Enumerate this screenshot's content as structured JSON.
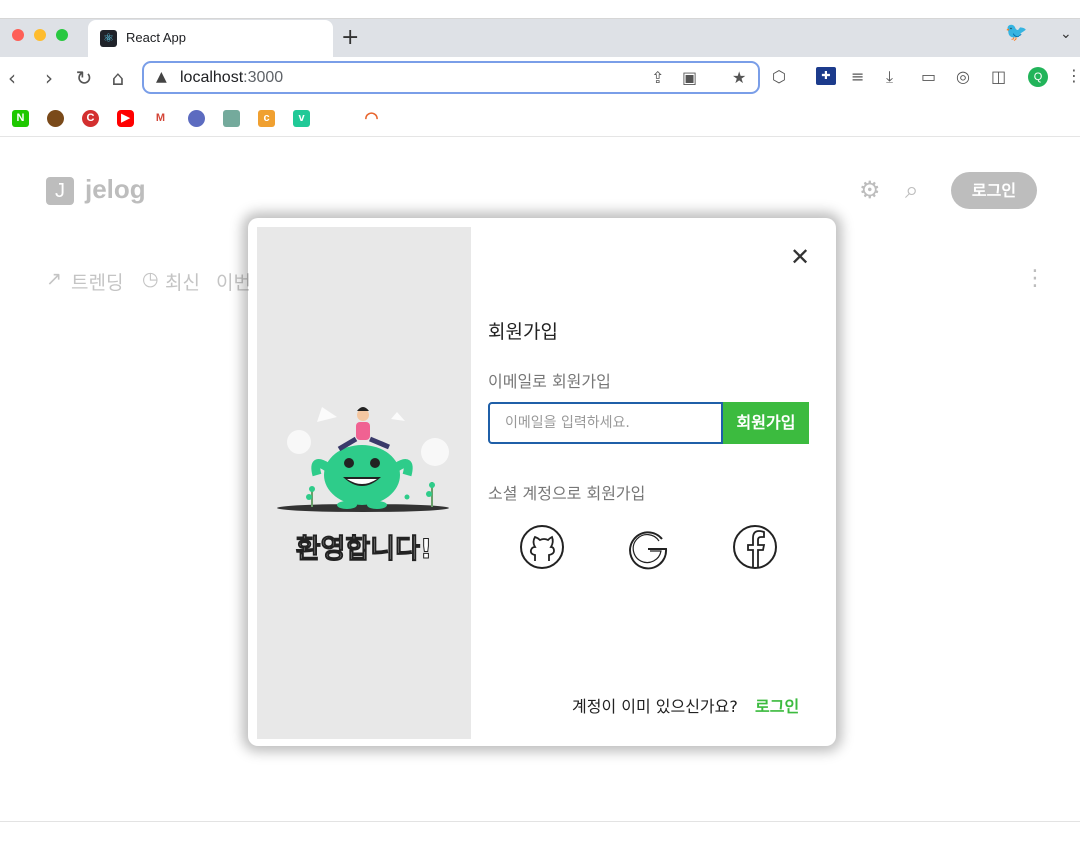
{
  "browser": {
    "tab_title": "React App",
    "new_tab": "+",
    "url_host": "localhost",
    "url_port": ":3000",
    "profile_initial": "Q",
    "bookmarks": [
      "N",
      "",
      "C",
      "",
      "M",
      "",
      "",
      "c",
      "v",
      ""
    ]
  },
  "header": {
    "logo_letter": "J",
    "logo_text": "jelog",
    "login_label": "로그인"
  },
  "nav": {
    "trending": "트렌딩",
    "recent": "최신",
    "period": "이번"
  },
  "modal": {
    "welcome": "환영합니다!",
    "title": "회원가입",
    "email_label": "이메일로 회원가입",
    "email_placeholder": "이메일을 입력하세요.",
    "signup_button": "회원가입",
    "social_label": "소셜 계정으로 회원가입",
    "social": [
      "github-icon",
      "google-icon",
      "facebook-icon"
    ],
    "has_account": "계정이 이미 있으신가요?",
    "login_link": "로그인"
  },
  "colors": {
    "accent_green": "#3cbb3f",
    "input_border": "#1f5fa8",
    "muted_gray": "#bdbdbd"
  }
}
